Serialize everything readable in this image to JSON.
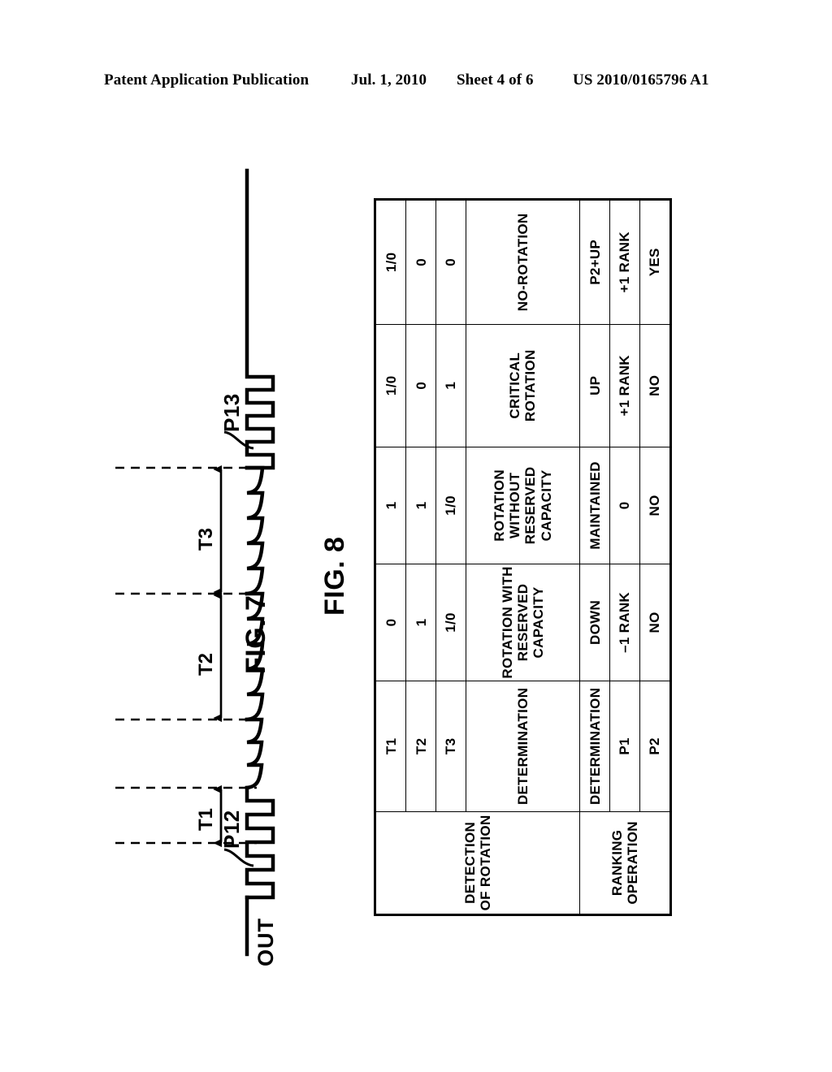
{
  "header": {
    "publication": "Patent Application Publication",
    "date": "Jul. 1, 2010",
    "sheet": "Sheet 4 of 6",
    "number": "US 2010/0165796 A1"
  },
  "fig7": {
    "caption": "FIG. 7",
    "axis_label": "OUT",
    "callouts": [
      {
        "id": "p12",
        "label": "P12"
      },
      {
        "id": "p13",
        "label": "P13"
      }
    ],
    "intervals": [
      {
        "id": "t1",
        "label": "T1"
      },
      {
        "id": "t2",
        "label": "T2"
      },
      {
        "id": "t3",
        "label": "T3"
      }
    ]
  },
  "fig8": {
    "caption": "FIG. 8",
    "group_headers": [
      {
        "id": "detection",
        "label": "DETECTION OF ROTATION",
        "span": 4
      },
      {
        "id": "ranking",
        "label": "RANKING OPERATION",
        "span": 3
      }
    ],
    "column_headers": [
      "T1",
      "T2",
      "T3",
      "DETERMINATION",
      "DETERMINATION",
      "P1",
      "P2"
    ],
    "rows": [
      {
        "t1": "0",
        "t2": "1",
        "t3": "1/0",
        "detection_determination": "ROTATION WITH\nRESERVED CAPACITY",
        "ranking_determination": "DOWN",
        "p1": "–1 RANK",
        "p2": "NO"
      },
      {
        "t1": "1",
        "t2": "1",
        "t3": "1/0",
        "detection_determination": "ROTATION WITHOUT\nRESERVED CAPACITY",
        "ranking_determination": "MAINTAINED",
        "p1": "0",
        "p2": "NO"
      },
      {
        "t1": "1/0",
        "t2": "0",
        "t3": "1",
        "detection_determination": "CRITICAL ROTATION",
        "ranking_determination": "UP",
        "p1": "+1 RANK",
        "p2": "NO"
      },
      {
        "t1": "1/0",
        "t2": "0",
        "t3": "0",
        "detection_determination": "NO-ROTATION",
        "ranking_determination": "P2+UP",
        "p1": "+1 RANK",
        "p2": "YES"
      }
    ]
  },
  "colors": {
    "ink": "#000000",
    "paper": "#ffffff"
  }
}
